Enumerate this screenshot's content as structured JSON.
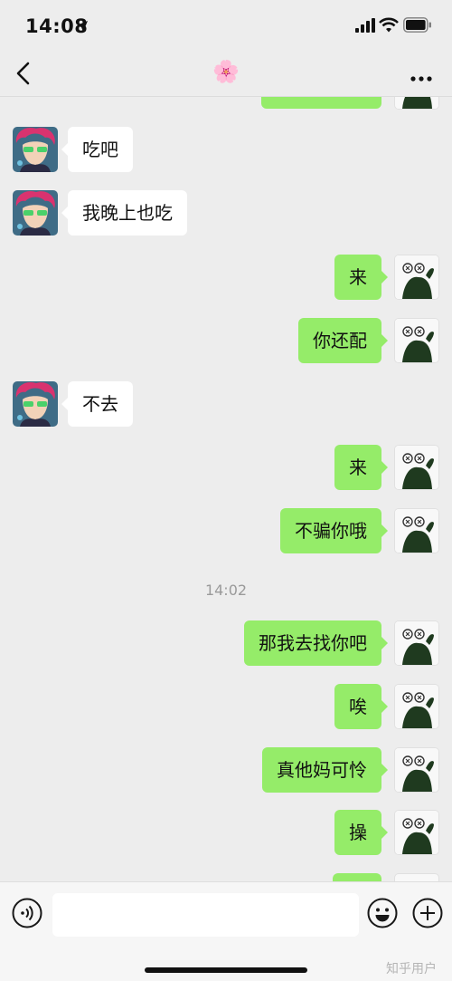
{
  "status_bar": {
    "time": "14:08"
  },
  "header": {
    "title": "🌸"
  },
  "messages": [
    {
      "side": "right",
      "text": ""
    },
    {
      "side": "left",
      "text": "吃吧"
    },
    {
      "side": "left",
      "text": "我晚上也吃"
    },
    {
      "side": "right",
      "text": "来"
    },
    {
      "side": "right",
      "text": "你还配"
    },
    {
      "side": "left",
      "text": "不去"
    },
    {
      "side": "right",
      "text": "来"
    },
    {
      "side": "right",
      "text": "不骗你哦"
    },
    {
      "side": "time",
      "text": "14:02"
    },
    {
      "side": "right",
      "text": "那我去找你吧"
    },
    {
      "side": "right",
      "text": "唉"
    },
    {
      "side": "right",
      "text": "真他妈可怜"
    },
    {
      "side": "right",
      "text": "操"
    },
    {
      "side": "right",
      "text": ""
    }
  ],
  "input": {
    "value": ""
  },
  "watermark": "知乎用户",
  "colors": {
    "background": "#ededed",
    "sent_bubble": "#95ec69",
    "received_bubble": "#ffffff"
  },
  "icons": [
    "location-arrow-icon",
    "cellular-signal-icon",
    "wifi-icon",
    "battery-icon",
    "back-chevron-icon",
    "more-dots-icon",
    "voice-icon",
    "emoji-icon",
    "plus-icon"
  ]
}
